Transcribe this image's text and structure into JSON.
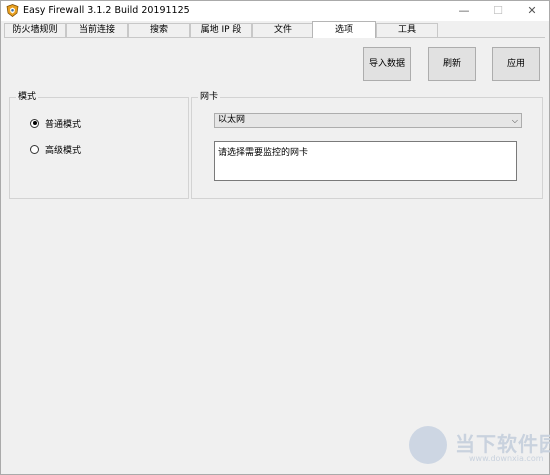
{
  "window": {
    "title": "Easy Firewall 3.1.2 Build 20191125",
    "controls": {
      "minimize": "—",
      "maximize": "☐",
      "close": "✕"
    }
  },
  "tabs": [
    {
      "label": "防火墙规则",
      "active": false
    },
    {
      "label": "当前连接",
      "active": false
    },
    {
      "label": "搜索",
      "active": false
    },
    {
      "label": "属地 IP 段",
      "active": false
    },
    {
      "label": "文件",
      "active": false
    },
    {
      "label": "选项",
      "active": true
    },
    {
      "label": "工具",
      "active": false
    }
  ],
  "toolbar": {
    "import_label": "导入数据",
    "refresh_label": "刷新",
    "apply_label": "应用"
  },
  "mode": {
    "title": "模式",
    "options": [
      {
        "label": "普通模式",
        "checked": true
      },
      {
        "label": "高级模式",
        "checked": false
      }
    ]
  },
  "nic": {
    "title": "网卡",
    "selected": "以太网",
    "hint": "请选择需要监控的网卡"
  },
  "watermark": {
    "text": "当下软件园",
    "sub": "www.downxia.com"
  },
  "colors": {
    "background": "#f0f0f0",
    "tab_active": "#ffffff",
    "button": "#e1e1e1",
    "border": "#adadad"
  }
}
